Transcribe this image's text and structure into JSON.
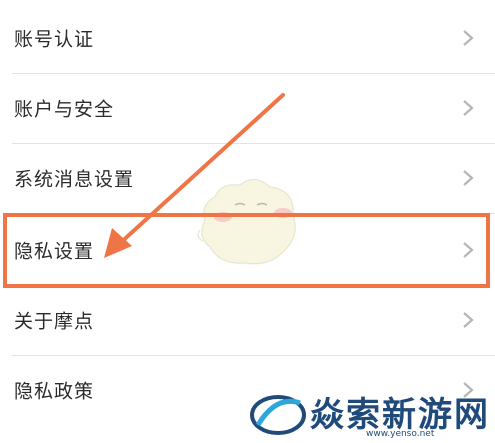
{
  "settings": {
    "items": [
      {
        "label": "账号认证"
      },
      {
        "label": "账户与安全"
      },
      {
        "label": "系统消息设置"
      },
      {
        "label": "隐私设置"
      },
      {
        "label": "关于摩点"
      },
      {
        "label": "隐私政策"
      }
    ]
  },
  "annotation": {
    "color": "#ef7547"
  },
  "watermark": {
    "text": "焱索新游网",
    "url": "www.yenso.net"
  }
}
